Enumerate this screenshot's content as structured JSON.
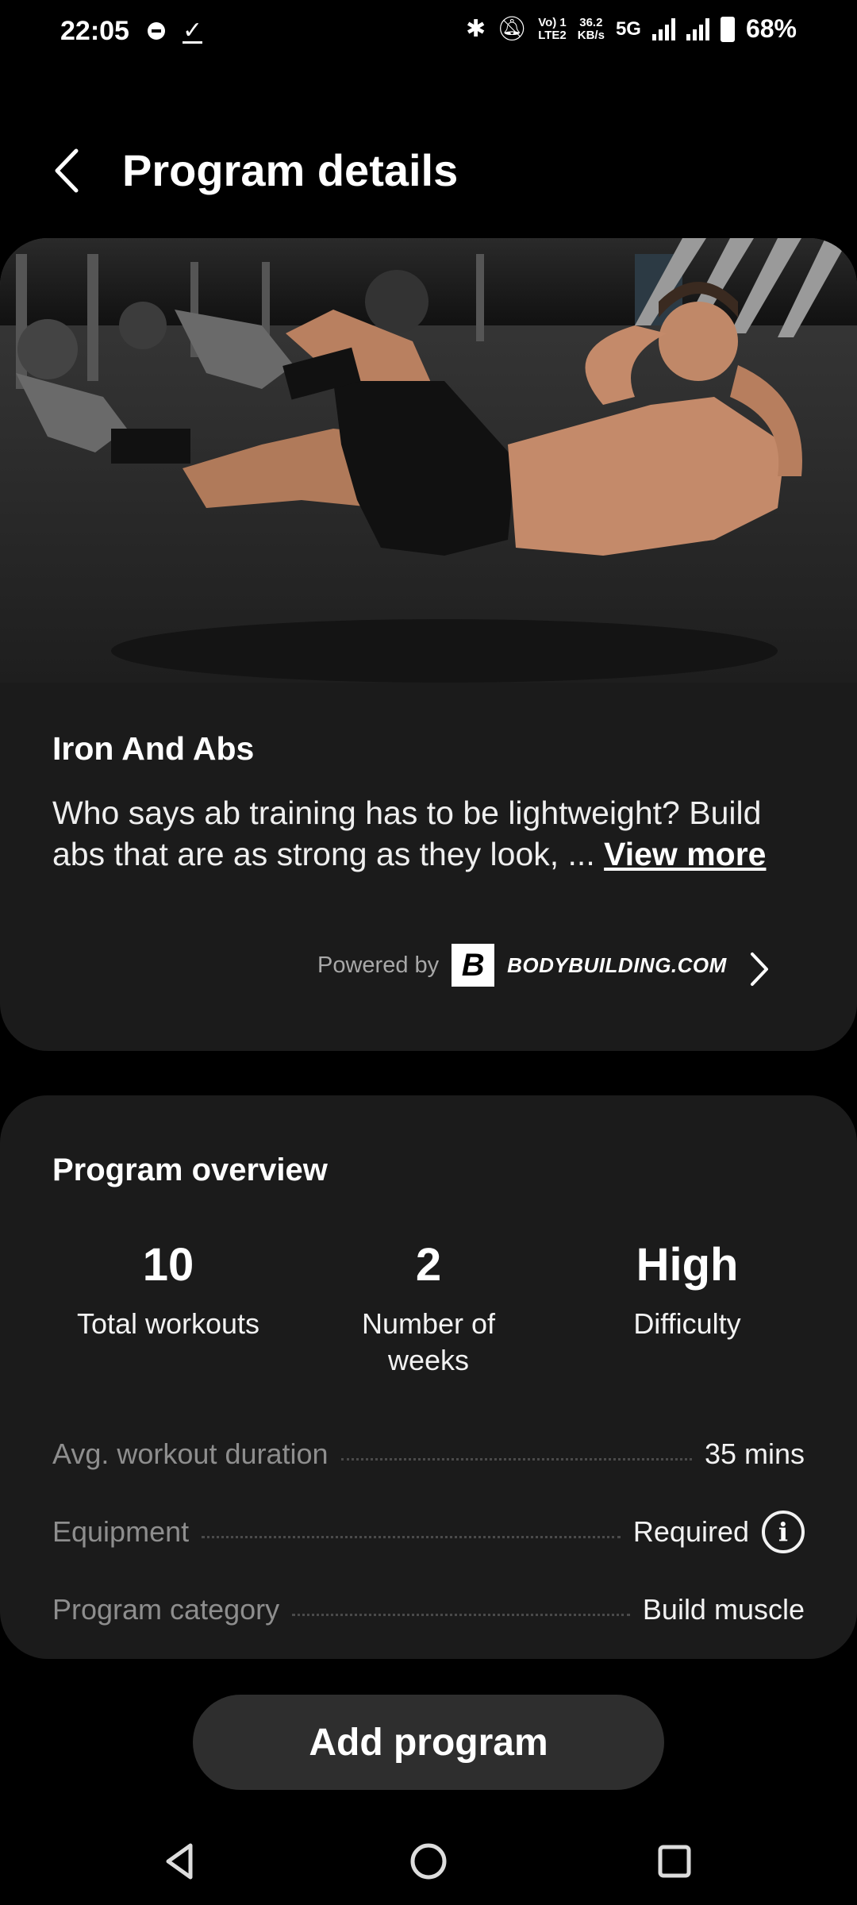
{
  "status_bar": {
    "time": "22:05",
    "net_speed_top": "36.2",
    "net_speed_bottom": "KB/s",
    "volte_top": "Vo) 1",
    "volte_bottom": "LTE2",
    "network": "5G",
    "battery": "68%",
    "icons": [
      "notification-dot-icon",
      "check-icon",
      "bluetooth-icon",
      "mute-icon",
      "signal-icon",
      "battery-icon"
    ]
  },
  "header": {
    "title": "Program details",
    "back_icon": "chevron-left-icon"
  },
  "program": {
    "name": "Iron And Abs",
    "description": "Who says ab training has to be lightweight? Build abs that are as strong as they look, ...",
    "view_more": "View more",
    "powered_by": "Powered by",
    "provider_logo_letter": "B",
    "provider": "BODYBUILDING.COM"
  },
  "overview": {
    "title": "Program overview",
    "stats": [
      {
        "value": "10",
        "label": "Total workouts"
      },
      {
        "value": "2",
        "label": "Number of weeks"
      },
      {
        "value": "High",
        "label": "Difficulty"
      }
    ],
    "details": [
      {
        "label": "Avg. workout duration",
        "value": "35 mins"
      },
      {
        "label": "Equipment",
        "value": "Required"
      },
      {
        "label": "Program category",
        "value": "Build muscle"
      }
    ]
  },
  "actions": {
    "add_program": "Add program"
  },
  "colors": {
    "background": "#000000",
    "card": "#1b1b1b",
    "button": "#2e2e2e",
    "muted_text": "#8e8e8e"
  }
}
